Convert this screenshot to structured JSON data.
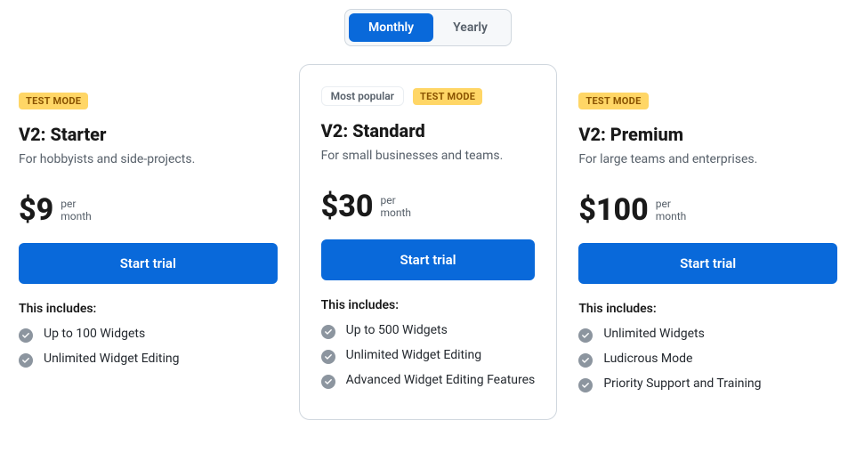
{
  "toggle": {
    "monthly": "Monthly",
    "yearly": "Yearly"
  },
  "labels": {
    "most_popular": "Most popular",
    "test_mode": "TEST MODE",
    "per": "per",
    "month": "month",
    "includes": "This includes:"
  },
  "plans": {
    "starter": {
      "title": "V2: Starter",
      "desc": "For hobbyists and side-projects.",
      "price": "$9",
      "cta": "Start trial",
      "features": [
        "Up to 100 Widgets",
        "Unlimited Widget Editing"
      ]
    },
    "standard": {
      "title": "V2: Standard",
      "desc": "For small businesses and teams.",
      "price": "$30",
      "cta": "Start trial",
      "features": [
        "Up to 500 Widgets",
        "Unlimited Widget Editing",
        "Advanced Widget Editing Features"
      ]
    },
    "premium": {
      "title": "V2: Premium",
      "desc": "For large teams and enterprises.",
      "price": "$100",
      "cta": "Start trial",
      "features": [
        "Unlimited Widgets",
        "Ludicrous Mode",
        "Priority Support and Training"
      ]
    }
  }
}
